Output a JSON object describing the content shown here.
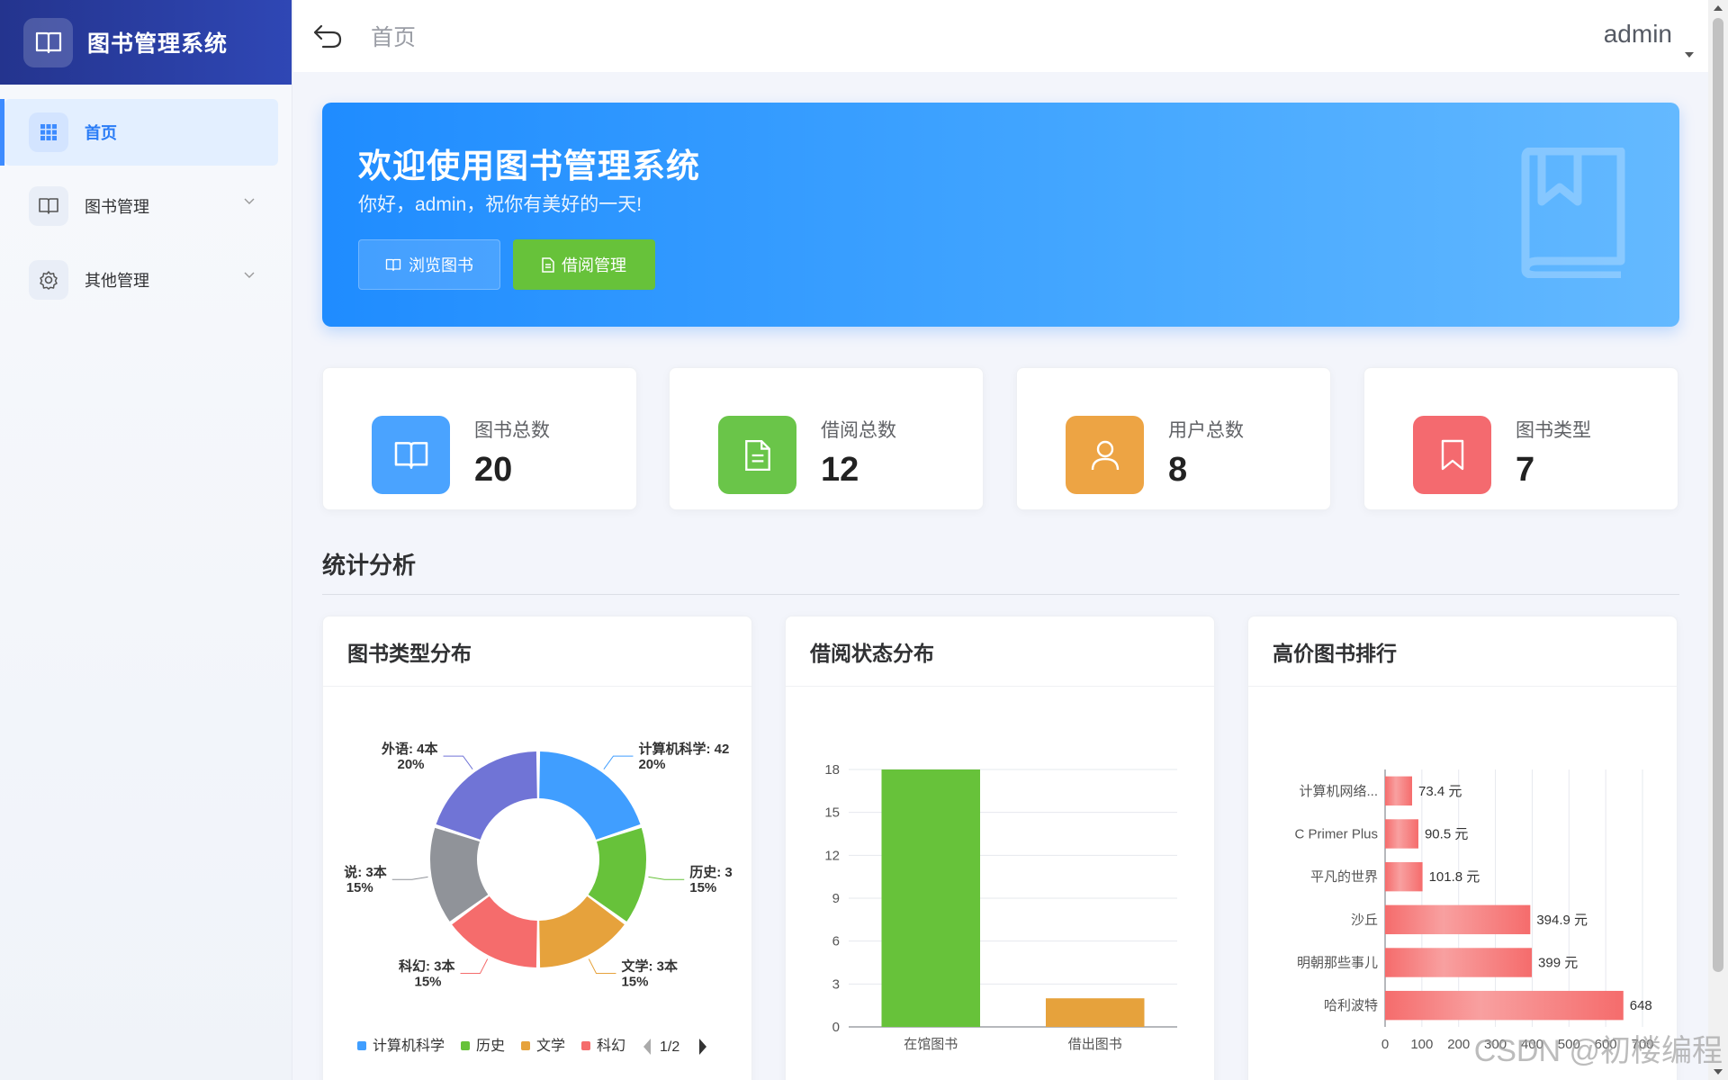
{
  "app": {
    "title": "图书管理系统"
  },
  "sidebar": {
    "items": [
      {
        "label": "首页",
        "active": true,
        "icon": "grid-icon"
      },
      {
        "label": "图书管理",
        "icon": "book-icon"
      },
      {
        "label": "其他管理",
        "icon": "gear-icon"
      }
    ]
  },
  "header": {
    "breadcrumb": "首页",
    "user": "admin"
  },
  "banner": {
    "title": "欢迎使用图书管理系统",
    "subtitle": "你好，admin，祝你有美好的一天!",
    "browse_label": "浏览图书",
    "borrow_label": "借阅管理"
  },
  "stats": [
    {
      "label": "图书总数",
      "value": "20",
      "color": "#4aa3ff"
    },
    {
      "label": "借阅总数",
      "value": "12",
      "color": "#6ac549"
    },
    {
      "label": "用户总数",
      "value": "8",
      "color": "#eda444"
    },
    {
      "label": "图书类型",
      "value": "7",
      "color": "#f46a6f"
    }
  ],
  "section": {
    "title": "统计分析"
  },
  "panels": {
    "type_title": "图书类型分布",
    "status_title": "借阅状态分布",
    "price_title": "高价图书排行"
  },
  "watermark": "CSDN @初楼编程",
  "chart_data": [
    {
      "type": "pie",
      "title": "图书类型分布",
      "slices": [
        {
          "name": "计算机科学",
          "value": 4,
          "percent": 20,
          "label": "计算机科学: 42",
          "pct_label": "20%",
          "color": "#409eff"
        },
        {
          "name": "历史",
          "value": 3,
          "percent": 15,
          "label": "历史: 3",
          "pct_label": "15%",
          "color": "#67c23a"
        },
        {
          "name": "文学",
          "value": 3,
          "percent": 15,
          "label": "文学: 3本",
          "pct_label": "15%",
          "color": "#e6a23c"
        },
        {
          "name": "科幻",
          "value": 3,
          "percent": 15,
          "label": "科幻: 3本",
          "pct_label": "15%",
          "color": "#f56c6c"
        },
        {
          "name": "小说",
          "value": 3,
          "percent": 15,
          "label": "说: 3本",
          "pct_label": "15%",
          "color": "#909399"
        },
        {
          "name": "外语",
          "value": 4,
          "percent": 20,
          "label": "外语: 4本",
          "pct_label": "20%",
          "color": "#7074d6"
        }
      ],
      "legend": [
        "计算机科学",
        "历史",
        "文学",
        "科幻"
      ],
      "legend_page": "1/2"
    },
    {
      "type": "bar",
      "title": "借阅状态分布",
      "categories": [
        "在馆图书",
        "借出图书"
      ],
      "values": [
        18,
        2
      ],
      "colors": [
        "#67c23a",
        "#e6a23c"
      ],
      "yticks": [
        0,
        3,
        6,
        9,
        12,
        15,
        18
      ],
      "ylim": [
        0,
        18
      ]
    },
    {
      "type": "bar",
      "orientation": "horizontal",
      "title": "高价图书排行",
      "categories": [
        "计算机网络...",
        "C Primer Plus",
        "平凡的世界",
        "沙丘",
        "明朝那些事儿",
        "哈利波特"
      ],
      "values": [
        73.4,
        90.5,
        101.8,
        394.9,
        399,
        648
      ],
      "value_labels": [
        "73.4 元",
        "90.5 元",
        "101.8 元",
        "394.9 元",
        "399 元",
        "648"
      ],
      "xticks": [
        0,
        100,
        200,
        300,
        400,
        500,
        600,
        700
      ],
      "xlim": [
        0,
        700
      ],
      "color": "#f56c6c"
    }
  ]
}
